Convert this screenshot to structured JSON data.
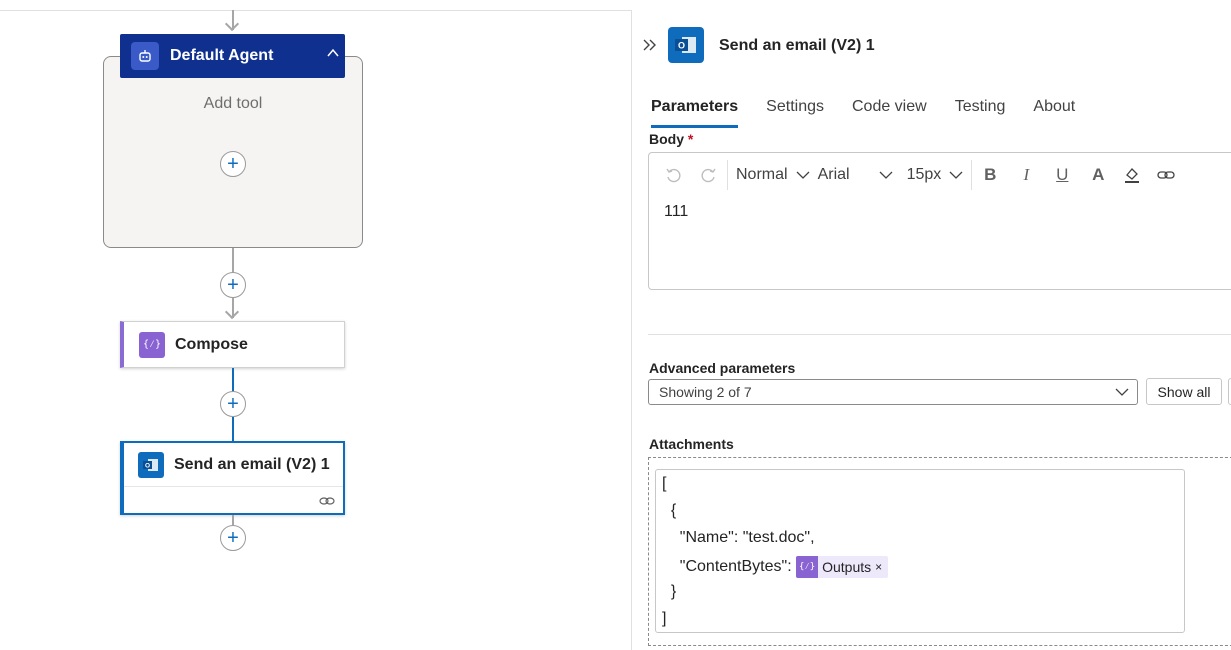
{
  "canvas": {
    "agent": {
      "title": "Default Agent",
      "add_tool": "Add tool"
    },
    "compose": {
      "title": "Compose",
      "icon_text": "{⁄}"
    },
    "email": {
      "title": "Send an email (V2) 1"
    }
  },
  "panel": {
    "title": "Send an email (V2) 1",
    "tabs": [
      {
        "label": "Parameters",
        "active": true
      },
      {
        "label": "Settings"
      },
      {
        "label": "Code view"
      },
      {
        "label": "Testing"
      },
      {
        "label": "About"
      }
    ],
    "body": {
      "label": "Body",
      "required_mark": "*",
      "toolbar": {
        "style": "Normal",
        "font": "Arial",
        "size": "15px"
      },
      "content": "111"
    },
    "advanced": {
      "label": "Advanced parameters",
      "select_value": "Showing 2 of 7",
      "show_all": "Show all"
    },
    "attachments": {
      "label": "Attachments",
      "lines": {
        "l1": "[",
        "l2": "  {",
        "l3": "    \"Name\": \"test.doc\",",
        "l4": "    \"ContentBytes\": ",
        "l5": "  }",
        "l6": "]"
      },
      "token": {
        "label": "Outputs",
        "icon_text": "{⁄}",
        "remove": "×"
      }
    }
  },
  "colors": {
    "accent": "#0f6cbd",
    "agent_header": "#10308f",
    "compose": "#8a63d2"
  }
}
